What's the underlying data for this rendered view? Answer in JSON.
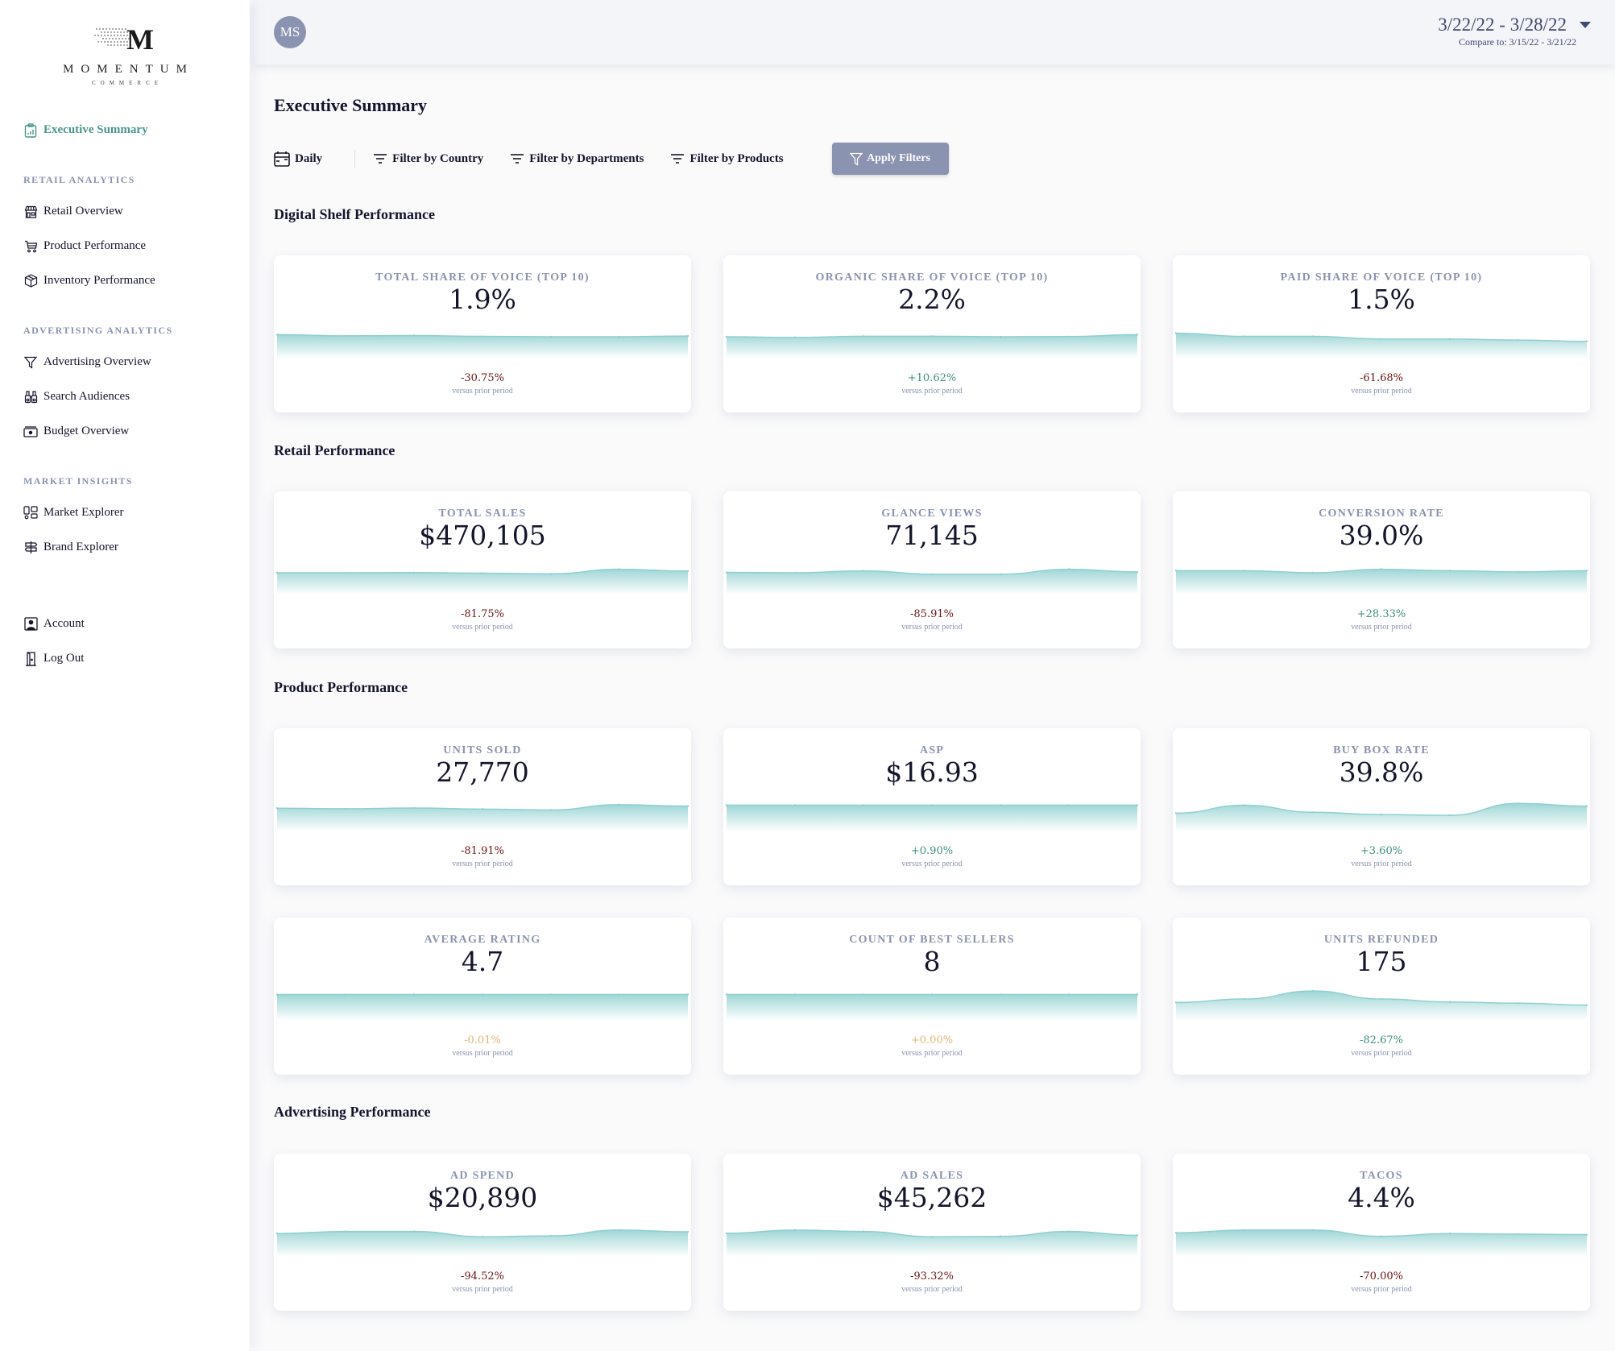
{
  "brand": {
    "name": "MOMENTUM",
    "tagline": "COMMERCE"
  },
  "sidebar": {
    "active": {
      "label": "Executive Summary",
      "icon": "clipboard-chart-icon"
    },
    "sections": [
      {
        "title": "RETAIL ANALYTICS",
        "items": [
          {
            "label": "Retail Overview",
            "icon": "storefront-icon"
          },
          {
            "label": "Product Performance",
            "icon": "cart-icon"
          },
          {
            "label": "Inventory Performance",
            "icon": "box-icon"
          }
        ]
      },
      {
        "title": "ADVERTISING ANALYTICS",
        "items": [
          {
            "label": "Advertising Overview",
            "icon": "funnel-icon"
          },
          {
            "label": "Search Audiences",
            "icon": "binoculars-icon"
          },
          {
            "label": "Budget Overview",
            "icon": "cash-icon"
          }
        ]
      },
      {
        "title": "MARKET INSIGHTS",
        "items": [
          {
            "label": "Market Explorer",
            "icon": "layout-icon"
          },
          {
            "label": "Brand Explorer",
            "icon": "signpost-icon"
          }
        ]
      }
    ],
    "footer": [
      {
        "label": "Account",
        "icon": "account-icon"
      },
      {
        "label": "Log Out",
        "icon": "door-icon"
      }
    ]
  },
  "header": {
    "avatar_initials": "MS",
    "date_range": "3/22/22 - 3/28/22",
    "compare_to": "Compare to: 3/15/22 - 3/21/22"
  },
  "page": {
    "title": "Executive Summary",
    "filters": {
      "granularity": "Daily",
      "country": "Filter by Country",
      "departments": "Filter by Departments",
      "products": "Filter by Products",
      "apply": "Apply Filters"
    }
  },
  "colors": {
    "positive": "#3f8f7f",
    "negative": "#6e1414",
    "neutral": "#e3b573",
    "spark": "#8fcfcf",
    "accent": "#4a968c"
  },
  "sections": [
    {
      "title": "Digital Shelf Performance",
      "cards": [
        {
          "label": "TOTAL SHARE OF VOICE (TOP 10)",
          "value": "1.9%",
          "change": "-30.75%",
          "trend": "negative",
          "sub": "versus prior period",
          "spark": [
            0.62,
            0.55,
            0.57,
            0.52,
            0.5,
            0.5,
            0.54
          ]
        },
        {
          "label": "ORGANIC SHARE OF VOICE (TOP 10)",
          "value": "2.2%",
          "change": "+10.62%",
          "trend": "positive",
          "sub": "versus prior period",
          "spark": [
            0.5,
            0.46,
            0.53,
            0.53,
            0.5,
            0.51,
            0.62
          ]
        },
        {
          "label": "PAID SHARE OF VOICE (TOP 10)",
          "value": "1.5%",
          "change": "-61.68%",
          "trend": "negative",
          "sub": "versus prior period",
          "spark": [
            0.7,
            0.52,
            0.52,
            0.37,
            0.37,
            0.31,
            0.24
          ]
        }
      ]
    },
    {
      "title": "Retail Performance",
      "cards": [
        {
          "label": "TOTAL SALES",
          "value": "$470,105",
          "change": "-81.75%",
          "trend": "negative",
          "sub": "versus prior period",
          "spark": [
            0.5,
            0.5,
            0.51,
            0.48,
            0.44,
            0.7,
            0.6
          ]
        },
        {
          "label": "GLANCE VIEWS",
          "value": "71,145",
          "change": "-85.91%",
          "trend": "negative",
          "sub": "versus prior period",
          "spark": [
            0.52,
            0.5,
            0.61,
            0.42,
            0.42,
            0.7,
            0.55
          ]
        },
        {
          "label": "CONVERSION RATE",
          "value": "39.0%",
          "change": "+28.33%",
          "trend": "positive",
          "sub": "versus prior period",
          "spark": [
            0.62,
            0.62,
            0.5,
            0.7,
            0.62,
            0.55,
            0.62
          ]
        }
      ]
    },
    {
      "title": "Product Performance",
      "cards": [
        {
          "label": "UNITS SOLD",
          "value": "27,770",
          "change": "-81.91%",
          "trend": "negative",
          "sub": "versus prior period",
          "spark": [
            0.58,
            0.55,
            0.59,
            0.53,
            0.48,
            0.78,
            0.7
          ]
        },
        {
          "label": "ASP",
          "value": "$16.93",
          "change": "+0.90%",
          "trend": "positive",
          "sub": "versus prior period",
          "spark": [
            0.75,
            0.75,
            0.75,
            0.75,
            0.75,
            0.75,
            0.75
          ]
        },
        {
          "label": "BUY BOX RATE",
          "value": "39.8%",
          "change": "+3.60%",
          "trend": "positive",
          "sub": "versus prior period",
          "spark": [
            0.3,
            0.75,
            0.35,
            0.22,
            0.18,
            0.85,
            0.7
          ]
        }
      ]
    },
    {
      "title": "",
      "cards": [
        {
          "label": "AVERAGE RATING",
          "value": "4.7",
          "change": "-0.01%",
          "trend": "neutral",
          "sub": "versus prior period",
          "spark": [
            0.75,
            0.75,
            0.75,
            0.75,
            0.75,
            0.75,
            0.75
          ]
        },
        {
          "label": "COUNT OF BEST SELLERS",
          "value": "8",
          "change": "+0.00%",
          "trend": "neutral",
          "sub": "versus prior period",
          "spark": [
            0.75,
            0.75,
            0.75,
            0.75,
            0.75,
            0.75,
            0.75
          ]
        },
        {
          "label": "UNITS REFUNDED",
          "value": "175",
          "change": "-82.67%",
          "trend": "positive",
          "sub": "versus prior period",
          "spark": [
            0.3,
            0.5,
            0.95,
            0.5,
            0.33,
            0.26,
            0.15
          ]
        }
      ]
    },
    {
      "title": "Advertising Performance",
      "cards": [
        {
          "label": "AD SPEND",
          "value": "$20,890",
          "change": "-94.52%",
          "trend": "negative",
          "sub": "versus prior period",
          "spark": [
            0.58,
            0.7,
            0.7,
            0.4,
            0.45,
            0.78,
            0.68
          ]
        },
        {
          "label": "AD SALES",
          "value": "$45,262",
          "change": "-93.32%",
          "trend": "negative",
          "sub": "versus prior period",
          "spark": [
            0.6,
            0.78,
            0.7,
            0.4,
            0.42,
            0.7,
            0.48
          ]
        },
        {
          "label": "TACOS",
          "value": "4.4%",
          "change": "-70.00%",
          "trend": "negative",
          "sub": "versus prior period",
          "spark": [
            0.62,
            0.78,
            0.78,
            0.42,
            0.58,
            0.55,
            0.52
          ]
        }
      ]
    }
  ]
}
